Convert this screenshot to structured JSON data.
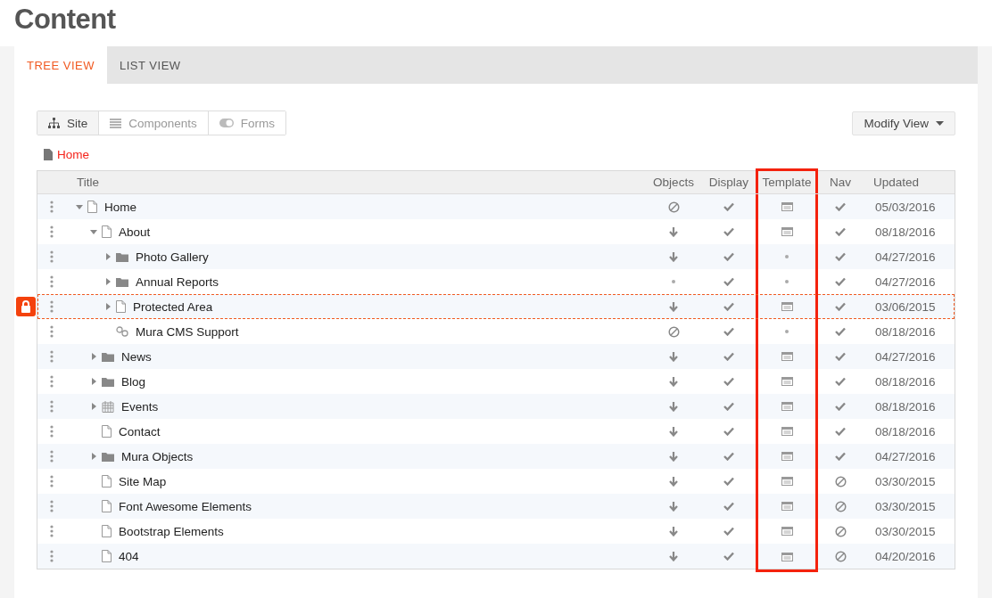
{
  "page_title": "Content",
  "tabs": [
    {
      "label": "TREE VIEW",
      "selected": true
    },
    {
      "label": "LIST VIEW",
      "selected": false
    }
  ],
  "segments": [
    {
      "label": "Site",
      "selected": true
    },
    {
      "label": "Components",
      "selected": false
    },
    {
      "label": "Forms",
      "selected": false
    }
  ],
  "modify_view": "Modify View",
  "breadcrumb": "Home",
  "columns": [
    {
      "label": "Title",
      "highlighted": false
    },
    {
      "label": "Objects",
      "highlighted": false
    },
    {
      "label": "Display",
      "highlighted": false
    },
    {
      "label": "Template",
      "highlighted": true
    },
    {
      "label": "Nav",
      "highlighted": false
    },
    {
      "label": "Updated",
      "highlighted": false
    }
  ],
  "rows": [
    {
      "title": "Home",
      "kind": "page",
      "expanded": true,
      "objects": {
        "kind": "blocked"
      },
      "display": true,
      "template": {
        "kind": "set"
      },
      "nav": true,
      "updated": "05/03/2016",
      "locked": false,
      "children": [
        {
          "title": "About",
          "kind": "page",
          "expanded": true,
          "objects": {
            "kind": "inherit"
          },
          "display": true,
          "template": {
            "kind": "set"
          },
          "nav": true,
          "updated": "08/18/2016",
          "locked": false,
          "children": [
            {
              "title": "Photo Gallery",
              "kind": "folder",
              "expanded": false,
              "objects": {
                "kind": "inherit"
              },
              "display": true,
              "template": {
                "kind": "inherit"
              },
              "nav": true,
              "updated": "04/27/2016",
              "locked": false
            },
            {
              "title": "Annual Reports",
              "kind": "folder",
              "expanded": false,
              "objects": {
                "kind": "default"
              },
              "display": true,
              "template": {
                "kind": "inherit"
              },
              "nav": true,
              "updated": "04/27/2016",
              "locked": false
            },
            {
              "title": "Protected Area",
              "kind": "page",
              "expanded": false,
              "objects": {
                "kind": "inherit"
              },
              "display": true,
              "template": {
                "kind": "set"
              },
              "nav": true,
              "updated": "03/06/2015",
              "locked": true
            },
            {
              "title": "Mura CMS Support",
              "kind": "link",
              "objects": {
                "kind": "blocked"
              },
              "display": true,
              "template": {
                "kind": "inherit"
              },
              "nav": true,
              "updated": "08/18/2016",
              "locked": false
            }
          ]
        },
        {
          "title": "News",
          "kind": "folder",
          "expanded": false,
          "objects": {
            "kind": "inherit"
          },
          "display": true,
          "template": {
            "kind": "set"
          },
          "nav": true,
          "updated": "04/27/2016",
          "locked": false
        },
        {
          "title": "Blog",
          "kind": "folder",
          "expanded": false,
          "objects": {
            "kind": "inherit"
          },
          "display": true,
          "template": {
            "kind": "set"
          },
          "nav": true,
          "updated": "08/18/2016",
          "locked": false
        },
        {
          "title": "Events",
          "kind": "calendar",
          "expanded": false,
          "objects": {
            "kind": "inherit"
          },
          "display": true,
          "template": {
            "kind": "set"
          },
          "nav": true,
          "updated": "08/18/2016",
          "locked": false
        },
        {
          "title": "Contact",
          "kind": "page",
          "objects": {
            "kind": "inherit"
          },
          "display": true,
          "template": {
            "kind": "set"
          },
          "nav": true,
          "updated": "08/18/2016",
          "locked": false
        },
        {
          "title": "Mura Objects",
          "kind": "folder",
          "expanded": false,
          "objects": {
            "kind": "inherit"
          },
          "display": true,
          "template": {
            "kind": "set"
          },
          "nav": true,
          "updated": "04/27/2016",
          "locked": false
        },
        {
          "title": "Site Map",
          "kind": "page",
          "objects": {
            "kind": "inherit"
          },
          "display": true,
          "template": {
            "kind": "set"
          },
          "nav": false,
          "updated": "03/30/2015",
          "locked": false
        },
        {
          "title": "Font Awesome Elements",
          "kind": "page",
          "objects": {
            "kind": "inherit"
          },
          "display": true,
          "template": {
            "kind": "set"
          },
          "nav": false,
          "updated": "03/30/2015",
          "locked": false
        },
        {
          "title": "Bootstrap Elements",
          "kind": "page",
          "objects": {
            "kind": "inherit"
          },
          "display": true,
          "template": {
            "kind": "set"
          },
          "nav": false,
          "updated": "03/30/2015",
          "locked": false
        },
        {
          "title": "404",
          "kind": "page",
          "objects": {
            "kind": "inherit"
          },
          "display": true,
          "template": {
            "kind": "set"
          },
          "nav": false,
          "updated": "04/20/2016",
          "locked": false
        }
      ]
    }
  ]
}
